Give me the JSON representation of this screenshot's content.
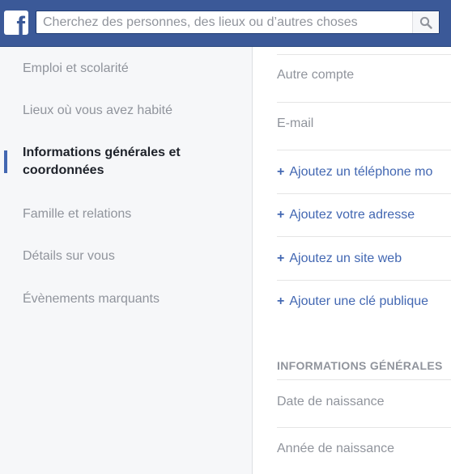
{
  "header": {
    "logo": "f",
    "search": {
      "placeholder": "Cherchez des personnes, des lieux ou d’autres choses",
      "icon": "search-icon"
    }
  },
  "sidebar": {
    "items": [
      {
        "label": "Emploi et scolarité",
        "active": false
      },
      {
        "label": "Lieux où vous avez habité",
        "active": false
      },
      {
        "label": "Informations générales et coordonnées",
        "active": true
      },
      {
        "label": "Famille et relations",
        "active": false
      },
      {
        "label": "Détails sur vous",
        "active": false
      },
      {
        "label": "Évènements marquants",
        "active": false
      }
    ]
  },
  "main": {
    "contact": {
      "other_account": "Autre compte",
      "email": "E-mail",
      "add_phone": "Ajoutez un téléphone mo",
      "add_address": "Ajoutez votre adresse",
      "add_website": "Ajoutez un site web",
      "add_public_key": "Ajouter une clé publique",
      "plus": "+"
    },
    "general": {
      "header": "INFORMATIONS GÉNÉRALES",
      "birth_date": "Date de naissance",
      "birth_year": "Année de naissance"
    }
  },
  "colors": {
    "brand": "#3b5998",
    "link": "#4267b2",
    "muted_text": "#90949c",
    "active_text": "#1d2129",
    "sidebar_bg": "#f6f7f9"
  }
}
